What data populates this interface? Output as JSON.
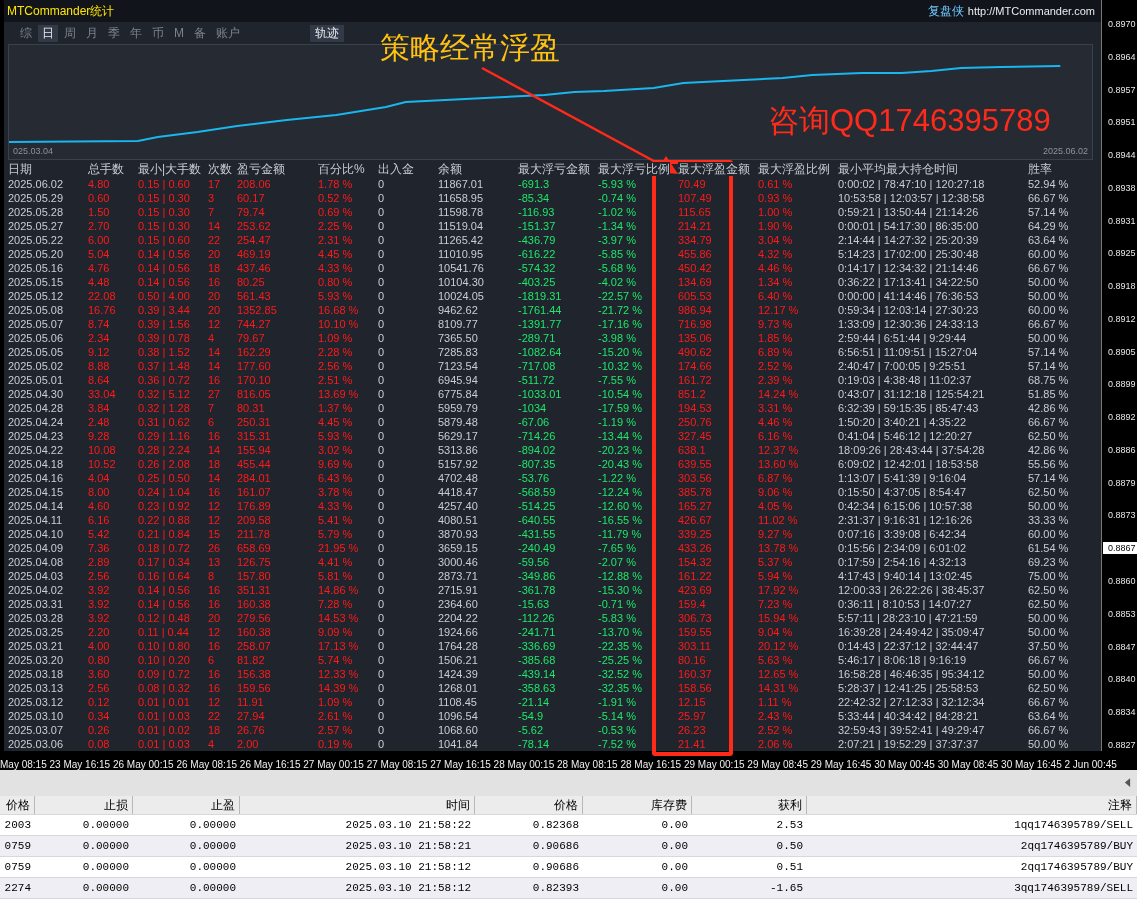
{
  "header": {
    "title": "MTCommander统计",
    "brand": "复盘侠",
    "url": "http://MTCommander.com"
  },
  "tabs": [
    {
      "label": "综",
      "selected": false
    },
    {
      "label": "日",
      "selected": true
    },
    {
      "label": "周",
      "selected": false
    },
    {
      "label": "月",
      "selected": false
    },
    {
      "label": "季",
      "selected": false
    },
    {
      "label": "年",
      "selected": false
    },
    {
      "label": "币",
      "selected": false
    },
    {
      "label": "M",
      "selected": false
    },
    {
      "label": "备",
      "selected": false
    },
    {
      "label": "账户",
      "selected": false
    }
  ],
  "track_button": "轨迹",
  "equity_chart": {
    "start_label": "025.03.04",
    "end_label": "2025.06.02"
  },
  "table": {
    "columns": [
      "日期",
      "总手数",
      "最小|大手数",
      "次数",
      "盈亏金额",
      "百分比%",
      "出入金",
      "余额",
      "最大浮亏金额",
      "最大浮亏比例",
      "最大浮盈金额",
      "最大浮盈比例",
      "最小平均最大持仓时间",
      "胜率"
    ],
    "rows": [
      [
        "2025.06.02",
        "4.80",
        "0.15 | 0.60",
        "17",
        "208.06",
        "1.78 %",
        "0",
        "11867.01",
        "-691.3",
        "-5.93 %",
        "70.49",
        "0.61 %",
        "0:00:02 | 78:47:10 | 120:27:18",
        "52.94 %"
      ],
      [
        "2025.05.29",
        "0.60",
        "0.15 | 0.30",
        "3",
        "60.17",
        "0.52 %",
        "0",
        "11658.95",
        "-85.34",
        "-0.74 %",
        "107.49",
        "0.93 %",
        "10:53:58 | 12:03:57 | 12:38:58",
        "66.67 %"
      ],
      [
        "2025.05.28",
        "1.50",
        "0.15 | 0.30",
        "7",
        "79.74",
        "0.69 %",
        "0",
        "11598.78",
        "-116.93",
        "-1.02 %",
        "115.65",
        "1.00 %",
        "0:59:21 | 13:50:44 | 21:14:26",
        "57.14 %"
      ],
      [
        "2025.05.27",
        "2.70",
        "0.15 | 0.30",
        "14",
        "253.62",
        "2.25 %",
        "0",
        "11519.04",
        "-151.37",
        "-1.34 %",
        "214.21",
        "1.90 %",
        "0:00:01 | 54:17:30 | 86:35:00",
        "64.29 %"
      ],
      [
        "2025.05.22",
        "6.00",
        "0.15 | 0.60",
        "22",
        "254.47",
        "2.31 %",
        "0",
        "11265.42",
        "-436.79",
        "-3.97 %",
        "334.79",
        "3.04 %",
        "2:14:44 | 14:27:32 | 25:20:39",
        "63.64 %"
      ],
      [
        "2025.05.20",
        "5.04",
        "0.14 | 0.56",
        "20",
        "469.19",
        "4.45 %",
        "0",
        "11010.95",
        "-616.22",
        "-5.85 %",
        "455.86",
        "4.32 %",
        "5:14:23 | 17:02:00 | 25:30:48",
        "60.00 %"
      ],
      [
        "2025.05.16",
        "4.76",
        "0.14 | 0.56",
        "18",
        "437.46",
        "4.33 %",
        "0",
        "10541.76",
        "-574.32",
        "-5.68 %",
        "450.42",
        "4.46 %",
        "0:14:17 | 12:34:32 | 21:14:46",
        "66.67 %"
      ],
      [
        "2025.05.15",
        "4.48",
        "0.14 | 0.56",
        "16",
        "80.25",
        "0.80 %",
        "0",
        "10104.30",
        "-403.25",
        "-4.02 %",
        "134.69",
        "1.34 %",
        "0:36:22 | 17:13:41 | 34:22:50",
        "50.00 %"
      ],
      [
        "2025.05.12",
        "22.08",
        "0.50 | 4.00",
        "20",
        "561.43",
        "5.93 %",
        "0",
        "10024.05",
        "-1819.31",
        "-22.57 %",
        "605.53",
        "6.40 %",
        "0:00:00 | 41:14:46 | 76:36:53",
        "50.00 %"
      ],
      [
        "2025.05.08",
        "16.76",
        "0.39 | 3.44",
        "20",
        "1352.85",
        "16.68 %",
        "0",
        "9462.62",
        "-1761.44",
        "-21.72 %",
        "986.94",
        "12.17 %",
        "0:59:34 | 12:03:14 | 27:30:23",
        "60.00 %"
      ],
      [
        "2025.05.07",
        "8.74",
        "0.39 | 1.56",
        "12",
        "744.27",
        "10.10 %",
        "0",
        "8109.77",
        "-1391.77",
        "-17.16 %",
        "716.98",
        "9.73 %",
        "1:33:09 | 12:30:36 | 24:33:13",
        "66.67 %"
      ],
      [
        "2025.05.06",
        "2.34",
        "0.39 | 0.78",
        "4",
        "79.67",
        "1.09 %",
        "0",
        "7365.50",
        "-289.71",
        "-3.98 %",
        "135.06",
        "1.85 %",
        "2:59:44 | 6:51:44 | 9:29:44",
        "50.00 %"
      ],
      [
        "2025.05.05",
        "9.12",
        "0.38 | 1.52",
        "14",
        "162.29",
        "2.28 %",
        "0",
        "7285.83",
        "-1082.64",
        "-15.20 %",
        "490.62",
        "6.89 %",
        "6:56:51 | 11:09:51 | 15:27:04",
        "57.14 %"
      ],
      [
        "2025.05.02",
        "8.88",
        "0.37 | 1.48",
        "14",
        "177.60",
        "2.56 %",
        "0",
        "7123.54",
        "-717.08",
        "-10.32 %",
        "174.66",
        "2.52 %",
        "2:40:47 | 7:00:05 | 9:25:51",
        "57.14 %"
      ],
      [
        "2025.05.01",
        "8.64",
        "0.36 | 0.72",
        "16",
        "170.10",
        "2.51 %",
        "0",
        "6945.94",
        "-511.72",
        "-7.55 %",
        "161.72",
        "2.39 %",
        "0:19:03 | 4:38:48 | 11:02:37",
        "68.75 %"
      ],
      [
        "2025.04.30",
        "33.04",
        "0.32 | 5.12",
        "27",
        "816.05",
        "13.69 %",
        "0",
        "6775.84",
        "-1033.01",
        "-10.54 %",
        "851.2",
        "14.24 %",
        "0:43:07 | 31:12:18 | 125:54:21",
        "51.85 %"
      ],
      [
        "2025.04.28",
        "3.84",
        "0.32 | 1.28",
        "7",
        "80.31",
        "1.37 %",
        "0",
        "5959.79",
        "-1034",
        "-17.59 %",
        "194.53",
        "3.31 %",
        "6:32:39 | 59:15:35 | 85:47:43",
        "42.86 %"
      ],
      [
        "2025.04.24",
        "2.48",
        "0.31 | 0.62",
        "6",
        "250.31",
        "4.45 %",
        "0",
        "5879.48",
        "-67.06",
        "-1.19 %",
        "250.76",
        "4.46 %",
        "1:50:20 | 3:40:21 | 4:35:22",
        "66.67 %"
      ],
      [
        "2025.04.23",
        "9.28",
        "0.29 | 1.16",
        "16",
        "315.31",
        "5.93 %",
        "0",
        "5629.17",
        "-714.26",
        "-13.44 %",
        "327.45",
        "6.16 %",
        "0:41:04 | 5:46:12 | 12:20:27",
        "62.50 %"
      ],
      [
        "2025.04.22",
        "10.08",
        "0.28 | 2.24",
        "14",
        "155.94",
        "3.02 %",
        "0",
        "5313.86",
        "-894.02",
        "-20.23 %",
        "638.1",
        "12.37 %",
        "18:09:26 | 28:43:44 | 37:54:28",
        "42.86 %"
      ],
      [
        "2025.04.18",
        "10.52",
        "0.26 | 2.08",
        "18",
        "455.44",
        "9.69 %",
        "0",
        "5157.92",
        "-807.35",
        "-20.43 %",
        "639.55",
        "13.60 %",
        "6:09:02 | 12:42:01 | 18:53:58",
        "55.56 %"
      ],
      [
        "2025.04.16",
        "4.04",
        "0.25 | 0.50",
        "14",
        "284.01",
        "6.43 %",
        "0",
        "4702.48",
        "-53.76",
        "-1.22 %",
        "303.56",
        "6.87 %",
        "1:13:07 | 5:41:39 | 9:16:04",
        "57.14 %"
      ],
      [
        "2025.04.15",
        "8.00",
        "0.24 | 1.04",
        "16",
        "161.07",
        "3.78 %",
        "0",
        "4418.47",
        "-568.59",
        "-12.24 %",
        "385.78",
        "9.06 %",
        "0:15:50 | 4:37:05 | 8:54:47",
        "62.50 %"
      ],
      [
        "2025.04.14",
        "4.60",
        "0.23 | 0.92",
        "12",
        "176.89",
        "4.33 %",
        "0",
        "4257.40",
        "-514.25",
        "-12.60 %",
        "165.27",
        "4.05 %",
        "0:42:34 | 6:15:06 | 10:57:38",
        "50.00 %"
      ],
      [
        "2025.04.11",
        "6.16",
        "0.22 | 0.88",
        "12",
        "209.58",
        "5.41 %",
        "0",
        "4080.51",
        "-640.55",
        "-16.55 %",
        "426.67",
        "11.02 %",
        "2:31:37 | 9:16:31 | 12:16:26",
        "33.33 %"
      ],
      [
        "2025.04.10",
        "5.42",
        "0.21 | 0.84",
        "15",
        "211.78",
        "5.79 %",
        "0",
        "3870.93",
        "-431.55",
        "-11.79 %",
        "339.25",
        "9.27 %",
        "0:07:16 | 3:39:08 | 6:42:34",
        "60.00 %"
      ],
      [
        "2025.04.09",
        "7.36",
        "0.18 | 0.72",
        "26",
        "658.69",
        "21.95 %",
        "0",
        "3659.15",
        "-240.49",
        "-7.65 %",
        "433.26",
        "13.78 %",
        "0:15:56 | 2:34:09 | 6:01:02",
        "61.54 %"
      ],
      [
        "2025.04.08",
        "2.89",
        "0.17 | 0.34",
        "13",
        "126.75",
        "4.41 %",
        "0",
        "3000.46",
        "-59.56",
        "-2.07 %",
        "154.32",
        "5.37 %",
        "0:17:59 | 2:54:16 | 4:32:13",
        "69.23 %"
      ],
      [
        "2025.04.03",
        "2.56",
        "0.16 | 0.64",
        "8",
        "157.80",
        "5.81 %",
        "0",
        "2873.71",
        "-349.86",
        "-12.88 %",
        "161.22",
        "5.94 %",
        "4:17:43 | 9:40:14 | 13:02:45",
        "75.00 %"
      ],
      [
        "2025.04.02",
        "3.92",
        "0.14 | 0.56",
        "16",
        "351.31",
        "14.86 %",
        "0",
        "2715.91",
        "-361.78",
        "-15.30 %",
        "423.69",
        "17.92 %",
        "12:00:33 | 26:22:26 | 38:45:37",
        "62.50 %"
      ],
      [
        "2025.03.31",
        "3.92",
        "0.14 | 0.56",
        "16",
        "160.38",
        "7.28 %",
        "0",
        "2364.60",
        "-15.63",
        "-0.71 %",
        "159.4",
        "7.23 %",
        "0:36:11 | 8:10:53 | 14:07:27",
        "62.50 %"
      ],
      [
        "2025.03.28",
        "3.92",
        "0.12 | 0.48",
        "20",
        "279.56",
        "14.53 %",
        "0",
        "2204.22",
        "-112.26",
        "-5.83 %",
        "306.73",
        "15.94 %",
        "5:57:11 | 28:23:10 | 47:21:59",
        "50.00 %"
      ],
      [
        "2025.03.25",
        "2.20",
        "0.11 | 0.44",
        "12",
        "160.38",
        "9.09 %",
        "0",
        "1924.66",
        "-241.71",
        "-13.70 %",
        "159.55",
        "9.04 %",
        "16:39:28 | 24:49:42 | 35:09:47",
        "50.00 %"
      ],
      [
        "2025.03.21",
        "4.00",
        "0.10 | 0.80",
        "16",
        "258.07",
        "17.13 %",
        "0",
        "1764.28",
        "-336.69",
        "-22.35 %",
        "303.11",
        "20.12 %",
        "0:14:43 | 22:37:12 | 32:44:47",
        "37.50 %"
      ],
      [
        "2025.03.20",
        "0.80",
        "0.10 | 0.20",
        "6",
        "81.82",
        "5.74 %",
        "0",
        "1506.21",
        "-385.68",
        "-25.25 %",
        "80.16",
        "5.63 %",
        "5:46:17 | 8:06:18 | 9:16:19",
        "66.67 %"
      ],
      [
        "2025.03.18",
        "3.60",
        "0.09 | 0.72",
        "16",
        "156.38",
        "12.33 %",
        "0",
        "1424.39",
        "-439.14",
        "-32.52 %",
        "160.37",
        "12.65 %",
        "16:58:28 | 46:46:35 | 95:34:12",
        "50.00 %"
      ],
      [
        "2025.03.13",
        "2.56",
        "0.08 | 0.32",
        "16",
        "159.56",
        "14.39 %",
        "0",
        "1268.01",
        "-358.63",
        "-32.35 %",
        "158.56",
        "14.31 %",
        "5:28:37 | 12:41:25 | 25:58:53",
        "62.50 %"
      ],
      [
        "2025.03.12",
        "0.12",
        "0.01 | 0.01",
        "12",
        "11.91",
        "1.09 %",
        "0",
        "1108.45",
        "-21.14",
        "-1.91 %",
        "12.15",
        "1.11 %",
        "22:42:32 | 27:12:33 | 32:12:34",
        "66.67 %"
      ],
      [
        "2025.03.10",
        "0.34",
        "0.01 | 0.03",
        "22",
        "27.94",
        "2.61 %",
        "0",
        "1096.54",
        "-54.9",
        "-5.14 %",
        "25.97",
        "2.43 %",
        "5:33:44 | 40:34:42 | 84:28:21",
        "63.64 %"
      ],
      [
        "2025.03.07",
        "0.26",
        "0.01 | 0.02",
        "18",
        "26.76",
        "2.57 %",
        "0",
        "1068.60",
        "-5.62",
        "-0.53 %",
        "26.23",
        "2.52 %",
        "32:59:43 | 39:52:41 | 49:29:47",
        "66.67 %"
      ],
      [
        "2025.03.06",
        "0.08",
        "0.01 | 0.03",
        "4",
        "2.00",
        "0.19 %",
        "0",
        "1041.84",
        "-78.14",
        "-7.52 %",
        "21.41",
        "2.06 %",
        "2:07:21 | 19:52:29 | 37:37:37",
        "50.00 %"
      ]
    ]
  },
  "price_axis": [
    {
      "label": "0.8970",
      "highlighted": false
    },
    {
      "label": "0.8964",
      "highlighted": false
    },
    {
      "label": "0.8957",
      "highlighted": false
    },
    {
      "label": "0.8951",
      "highlighted": false
    },
    {
      "label": "0.8944",
      "highlighted": false
    },
    {
      "label": "0.8938",
      "highlighted": false
    },
    {
      "label": "0.8931",
      "highlighted": false
    },
    {
      "label": "0.8925",
      "highlighted": false
    },
    {
      "label": "0.8918",
      "highlighted": false
    },
    {
      "label": "0.8912",
      "highlighted": false
    },
    {
      "label": "0.8905",
      "highlighted": false
    },
    {
      "label": "0.8899",
      "highlighted": false
    },
    {
      "label": "0.8892",
      "highlighted": false
    },
    {
      "label": "0.8886",
      "highlighted": false
    },
    {
      "label": "0.8879",
      "highlighted": false
    },
    {
      "label": "0.8873",
      "highlighted": false
    },
    {
      "label": "0.8867",
      "highlighted": true
    },
    {
      "label": "0.8860",
      "highlighted": false
    },
    {
      "label": "0.8853",
      "highlighted": false
    },
    {
      "label": "0.8847",
      "highlighted": false
    },
    {
      "label": "0.8840",
      "highlighted": false
    },
    {
      "label": "0.8834",
      "highlighted": false
    },
    {
      "label": "0.8827",
      "highlighted": false
    }
  ],
  "time_axis": [
    "May 08:15",
    "23 May 16:15",
    "26 May 00:15",
    "26 May 08:15",
    "26 May 16:15",
    "27 May 00:15",
    "27 May 08:15",
    "27 May 16:15",
    "28 May 00:15",
    "28 May 08:15",
    "28 May 16:15",
    "29 May 00:15",
    "29 May 08:45",
    "29 May 16:45",
    "30 May 00:45",
    "30 May 08:45",
    "30 May 16:45",
    "2 Jun 00:45"
  ],
  "orders": {
    "columns": [
      "价格",
      "止损",
      "止盈",
      "时间",
      "价格",
      "库存费",
      "获利",
      "注释"
    ],
    "rows": [
      [
        "2003",
        "0.00000",
        "0.00000",
        "2025.03.10 21:58:22",
        "0.82368",
        "0.00",
        "2.53",
        "1qq1746395789/SELL"
      ],
      [
        "0759",
        "0.00000",
        "0.00000",
        "2025.03.10 21:58:21",
        "0.90686",
        "0.00",
        "0.50",
        "2qq1746395789/BUY"
      ],
      [
        "0759",
        "0.00000",
        "0.00000",
        "2025.03.10 21:58:12",
        "0.90686",
        "0.00",
        "0.51",
        "2qq1746395789/BUY"
      ],
      [
        "2274",
        "0.00000",
        "0.00000",
        "2025.03.10 21:58:12",
        "0.82393",
        "0.00",
        "-1.65",
        "3qq1746395789/SELL"
      ]
    ]
  },
  "annotations": {
    "headline": "策略经常浮盈",
    "contact": "咨询QQ1746395789"
  }
}
